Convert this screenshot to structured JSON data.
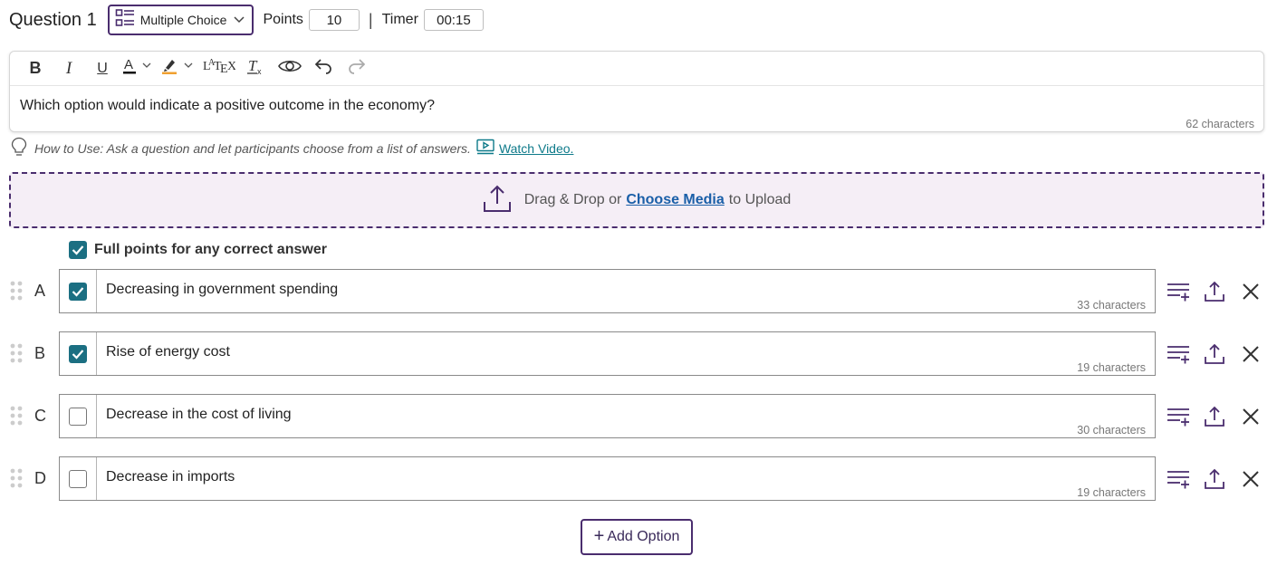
{
  "header": {
    "question_title": "Question 1",
    "type_label": "Multiple Choice",
    "points_label": "Points",
    "points_value": "10",
    "separator": "|",
    "timer_label": "Timer",
    "timer_value": "00:15"
  },
  "editor": {
    "toolbar": {
      "bold": "B",
      "italic": "I",
      "underline": "U",
      "latex": "LATEX"
    },
    "text": "Which option would indicate a positive outcome in the economy?",
    "char_count": "62 characters"
  },
  "hint": {
    "text": "How to Use: Ask a question and let participants choose from a list of answers.",
    "link": "Watch Video."
  },
  "upload": {
    "prefix": "Drag & Drop or",
    "link": "Choose Media",
    "suffix": "to Upload"
  },
  "full_points": {
    "label": "Full points for any correct answer",
    "checked": true
  },
  "options": [
    {
      "letter": "A",
      "text": "Decreasing in government spending",
      "char_count": "33 characters",
      "correct": true
    },
    {
      "letter": "B",
      "text": "Rise of energy cost",
      "char_count": "19 characters",
      "correct": true
    },
    {
      "letter": "C",
      "text": "Decrease in the cost of living",
      "char_count": "30 characters",
      "correct": false
    },
    {
      "letter": "D",
      "text": "Decrease in imports",
      "char_count": "19 characters",
      "correct": false
    }
  ],
  "add_option": {
    "plus": "+",
    "label": "Add Option"
  },
  "colors": {
    "brand_purple": "#4a2d6e",
    "checkbox_teal": "#1b6f82",
    "link_teal": "#0e7a8a",
    "link_blue": "#1a5fa8",
    "upload_bg": "#f5eef6"
  },
  "icons": {
    "type_select": "multiple-choice-icon",
    "option_actions": [
      "add-feedback-icon",
      "upload-icon",
      "close-icon"
    ]
  }
}
